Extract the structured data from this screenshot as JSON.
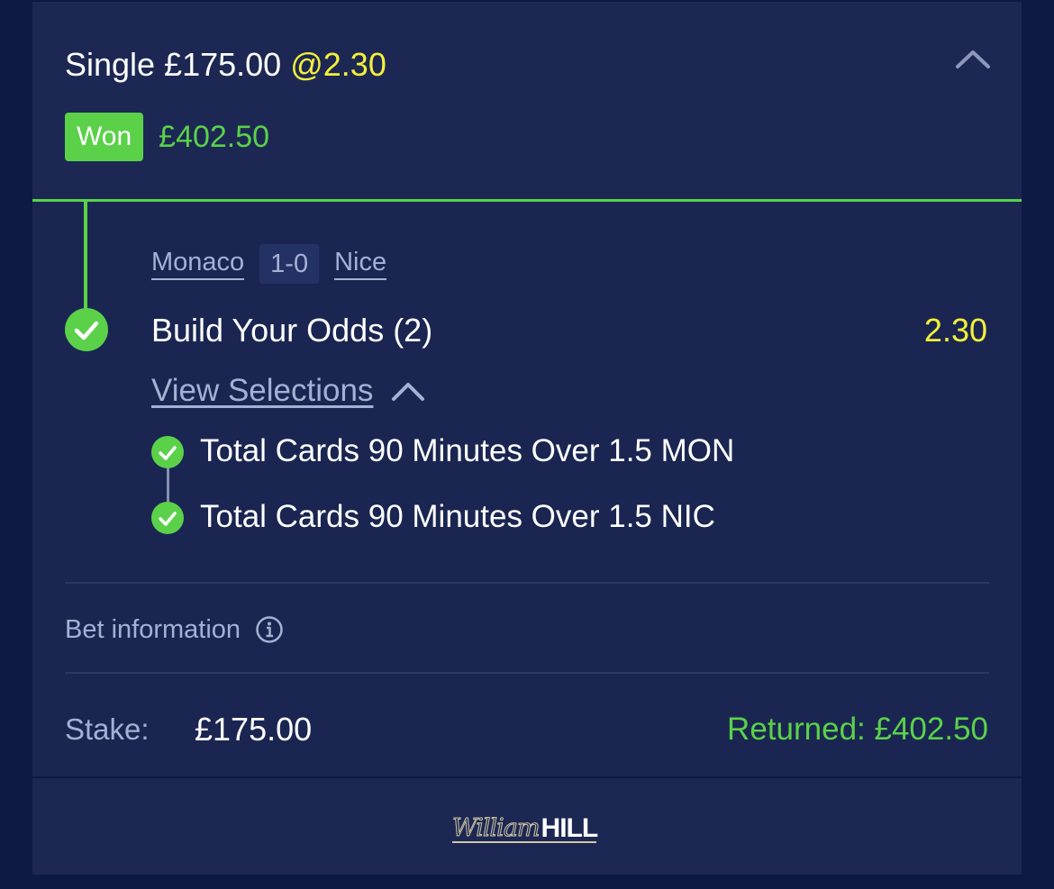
{
  "bet": {
    "title_prefix": "Single £175.00",
    "title_odds": "@2.30",
    "status_badge": "Won",
    "won_amount": "£402.50"
  },
  "leg": {
    "home_team": "Monaco",
    "score": "1-0",
    "away_team": "Nice",
    "market": "Build Your Odds (2)",
    "odds": "2.30",
    "view_selections_label": "View Selections",
    "selections": [
      "Total Cards 90 Minutes Over 1.5 MON",
      "Total Cards 90 Minutes Over 1.5 NIC"
    ]
  },
  "bet_info": {
    "label": "Bet information"
  },
  "summary": {
    "stake_label": "Stake:",
    "stake_value": "£175.00",
    "returned": "Returned: £402.50"
  },
  "footer": {
    "logo_script": "William",
    "logo_bold": "HILL"
  },
  "colors": {
    "background": "#0d1a45",
    "card": "#1a2651",
    "accent_green": "#5bd14a",
    "odds_yellow": "#f5ef3a",
    "muted_text": "#a6b0d6"
  },
  "icons": {
    "collapse": "chevron-up-icon",
    "check": "check-icon",
    "info": "info-icon"
  }
}
